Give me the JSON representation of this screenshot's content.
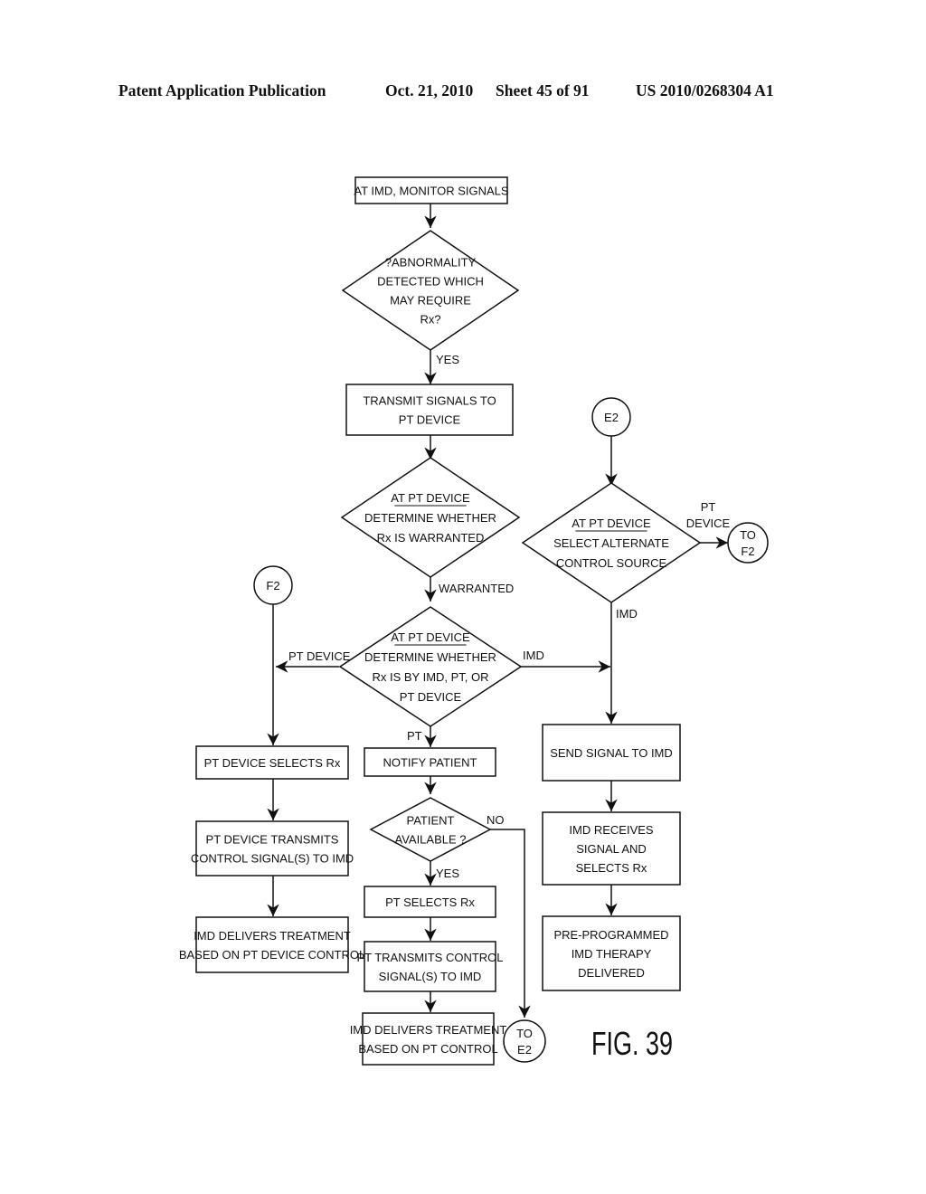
{
  "header": {
    "publication": "Patent Application Publication",
    "date": "Oct. 21, 2010",
    "sheet": "Sheet 45 of 91",
    "number": "US 2010/0268304 A1"
  },
  "figure_label": "FIG. 39",
  "nodes": {
    "monitor": {
      "lines": [
        "AT IMD, MONITOR SIGNALS"
      ]
    },
    "abnormality": {
      "lines": [
        "?ABNORMALITY",
        "DETECTED WHICH",
        "MAY REQUIRE",
        "Rx?"
      ]
    },
    "transmit": {
      "lines": [
        "TRANSMIT SIGNALS TO",
        "PT DEVICE"
      ]
    },
    "warranted_decision": {
      "title": "AT PT DEVICE",
      "lines": [
        "DETERMINE WHETHER",
        "Rx IS WARRANTED"
      ]
    },
    "who_decision": {
      "title": "AT PT DEVICE",
      "lines": [
        "DETERMINE WHETHER",
        "Rx IS BY IMD, PT, OR",
        "PT DEVICE"
      ]
    },
    "alt_source": {
      "title": "AT PT DEVICE",
      "lines": [
        "SELECT ALTERNATE",
        "CONTROL SOURCE"
      ]
    },
    "ptdev_selects": {
      "lines": [
        "PT DEVICE  SELECTS Rx"
      ]
    },
    "ptdev_transmits": {
      "lines": [
        "PT DEVICE TRANSMITS",
        "CONTROL SIGNAL(S) TO IMD"
      ]
    },
    "imd_delivers_ptdev": {
      "lines": [
        "IMD DELIVERS TREATMENT",
        "BASED ON PT DEVICE CONTROL"
      ]
    },
    "notify": {
      "lines": [
        "NOTIFY PATIENT"
      ]
    },
    "patient_available": {
      "lines": [
        "PATIENT",
        "AVAILABLE ?"
      ]
    },
    "pt_selects": {
      "lines": [
        "PT SELECTS Rx"
      ]
    },
    "pt_transmits": {
      "lines": [
        "PT TRANSMITS CONTROL",
        "SIGNAL(S) TO IMD"
      ]
    },
    "imd_delivers_pt": {
      "lines": [
        "IMD DELIVERS TREATMENT",
        "BASED ON PT CONTROL"
      ]
    },
    "send_signal": {
      "lines": [
        "SEND SIGNAL TO IMD"
      ]
    },
    "imd_receives": {
      "lines": [
        "IMD RECEIVES",
        "SIGNAL AND",
        "SELECTS Rx"
      ]
    },
    "preprogrammed": {
      "lines": [
        "PRE-PROGRAMMED",
        "IMD THERAPY",
        "DELIVERED"
      ]
    }
  },
  "connectors": {
    "e2_in": {
      "lines": [
        "E2"
      ]
    },
    "f2_in": {
      "lines": [
        "F2"
      ]
    },
    "to_f2": {
      "lines": [
        "TO",
        "F2"
      ]
    },
    "to_e2": {
      "lines": [
        "TO",
        "E2"
      ]
    }
  },
  "edge_labels": {
    "yes_abnormality": "YES",
    "warranted": "WARRANTED",
    "pt_device_left": "PT DEVICE",
    "imd_right": "IMD",
    "pt_down": "PT",
    "yes_available": "YES",
    "no_available": "NO",
    "imd_alt": "IMD",
    "pt_device_alt": [
      "PT",
      "DEVICE"
    ]
  }
}
